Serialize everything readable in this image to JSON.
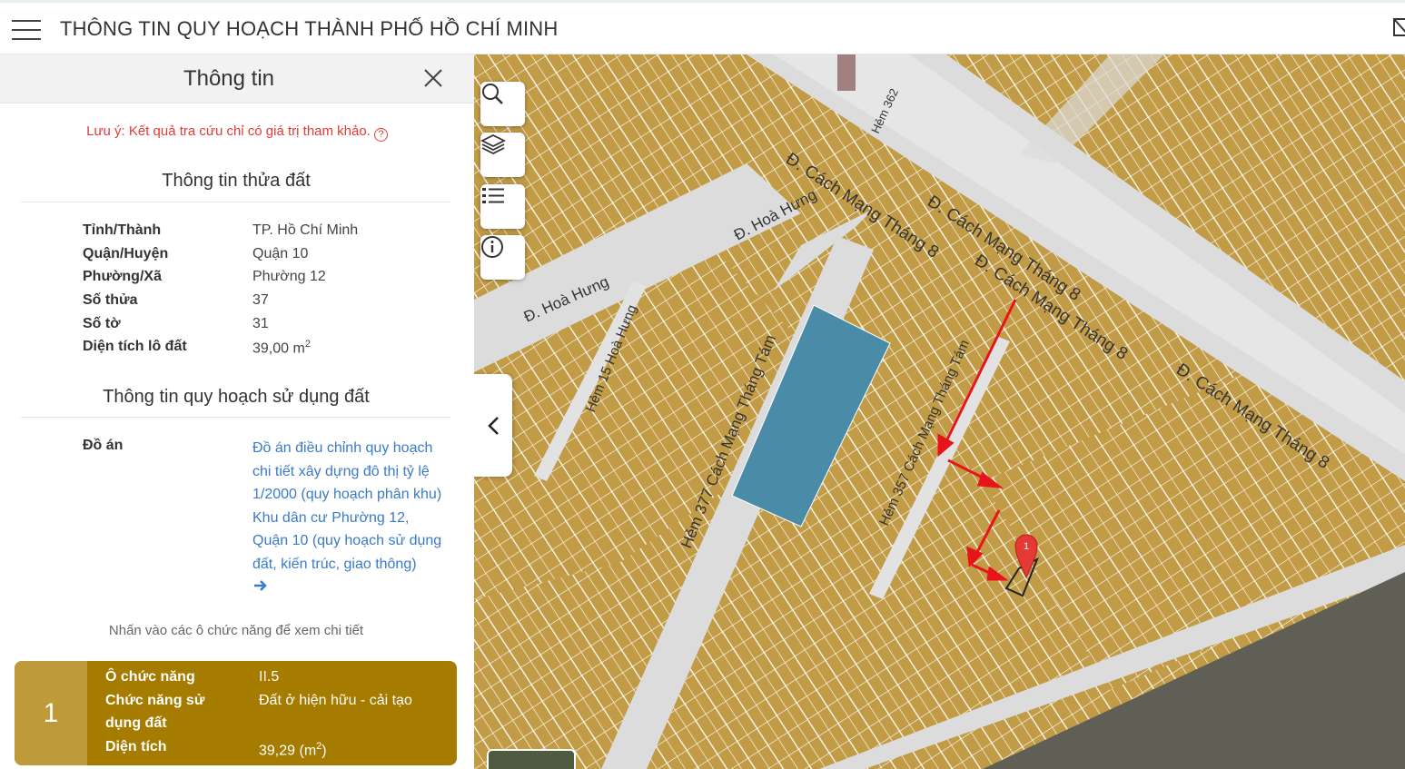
{
  "header": {
    "title": "THÔNG TIN QUY HOẠCH THÀNH PHỐ HỒ CHÍ MINH"
  },
  "panel": {
    "title": "Thông tin",
    "note": "Lưu ý: Kết quả tra cứu chỉ có giá trị tham khảo.",
    "note_help_glyph": "?",
    "land_section_title": "Thông tin thửa đất",
    "land": [
      {
        "label": "Tỉnh/Thành",
        "value": "TP. Hồ Chí Minh"
      },
      {
        "label": "Quận/Huyện",
        "value": "Quận 10"
      },
      {
        "label": "Phường/Xã",
        "value": "Phường 12"
      },
      {
        "label": "Số thửa",
        "value": "37"
      },
      {
        "label": "Số tờ",
        "value": "31"
      },
      {
        "label": "Diện tích lô đất",
        "value": "39,00 m",
        "unit_sup": "2"
      }
    ],
    "plan_section_title": "Thông tin quy hoạch sử dụng đất",
    "plan_label": "Đồ án",
    "plan_link": "Đồ án điều chỉnh quy hoạch chi tiết xây dựng đô thị tỷ lệ 1/2000 (quy hoạch phân khu) Khu dân cư Phường 12, Quận 10 (quy hoạch sử dụng đất, kiến trúc, giao thông)",
    "hint": "Nhấn vào các ô chức năng để xem chi tiết",
    "card": {
      "index": "1",
      "color": "#a67c00",
      "rows": [
        {
          "label": "Ô chức năng",
          "value": "II.5"
        },
        {
          "label": "Chức năng sử dụng đất",
          "value": "Đất ở hiện hữu - cải tạo"
        },
        {
          "label": "Diện tích",
          "value": "39,29 (m",
          "unit_sup": "2",
          "unit_close": ")"
        }
      ]
    }
  },
  "map": {
    "tools": [
      "search-icon",
      "layers-icon",
      "list-icon",
      "info-icon"
    ],
    "streets": {
      "cmt8_1": "Đ. Cách Mạng Tháng 8",
      "cmt8_2": "Đ. Cách Mạng Tháng 8",
      "cmt8_3": "Đ. Cách Mạng Tháng 8",
      "cmt8_4": "Đ. Cách Mạng Tháng 8",
      "hoa_hung_1": "Đ. Hoà Hưng",
      "hoa_hung_2": "Đ. Hoà Hưng",
      "hem_15": "Hẻm 15 Hoà Hưng",
      "hem_377": "Hẻm 377 Cách Mạng Tháng Tám",
      "hem_357": "Hẻm 357 Cách Mạng Tháng Tám",
      "hem_top": "Hẻm 362"
    },
    "marker_label": "1",
    "colors": {
      "parcel": "#c19b45",
      "road": "#dcdcdc",
      "highlight": "#4a8ca8",
      "marker": "#e53935",
      "arrow": "#e8141b"
    }
  }
}
